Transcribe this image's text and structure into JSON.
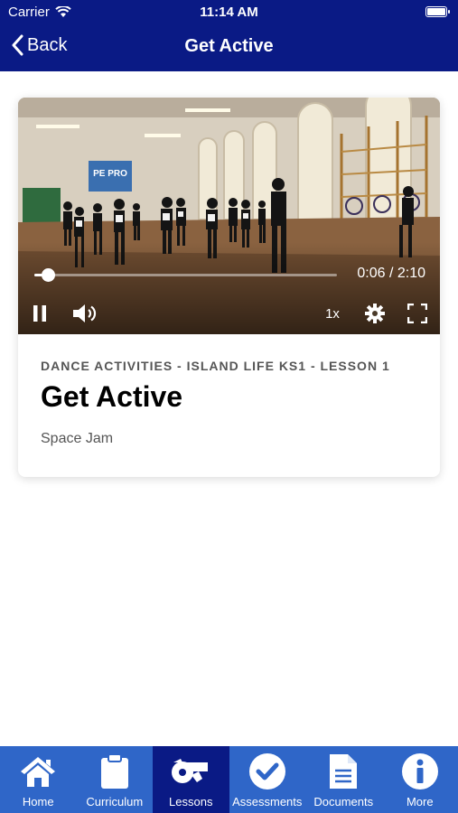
{
  "status_bar": {
    "carrier": "Carrier",
    "time": "11:14 AM"
  },
  "nav": {
    "back_label": "Back",
    "title": "Get Active"
  },
  "video": {
    "progress_fraction": 0.046,
    "current_time": "0:06",
    "duration": "2:10",
    "time_display": "0:06 / 2:10",
    "speed_label": "1x",
    "sign_text": "PE PRO"
  },
  "lesson": {
    "kicker": "DANCE ACTIVITIES - ISLAND LIFE KS1 - LESSON 1",
    "title": "Get Active",
    "subtitle": "Space Jam"
  },
  "tabbar": {
    "items": [
      {
        "label": "Home",
        "icon": "home-icon",
        "active": false
      },
      {
        "label": "Curriculum",
        "icon": "clipboard-icon",
        "active": false
      },
      {
        "label": "Lessons",
        "icon": "whistle-icon",
        "active": true
      },
      {
        "label": "Assessments",
        "icon": "checkmark-circle-icon",
        "active": false
      },
      {
        "label": "Documents",
        "icon": "document-icon",
        "active": false
      },
      {
        "label": "More",
        "icon": "info-icon",
        "active": false
      }
    ]
  },
  "colors": {
    "nav_bg": "#0a1a85",
    "tab_bg": "#2f66c8",
    "tab_active_bg": "#0a1a85"
  }
}
